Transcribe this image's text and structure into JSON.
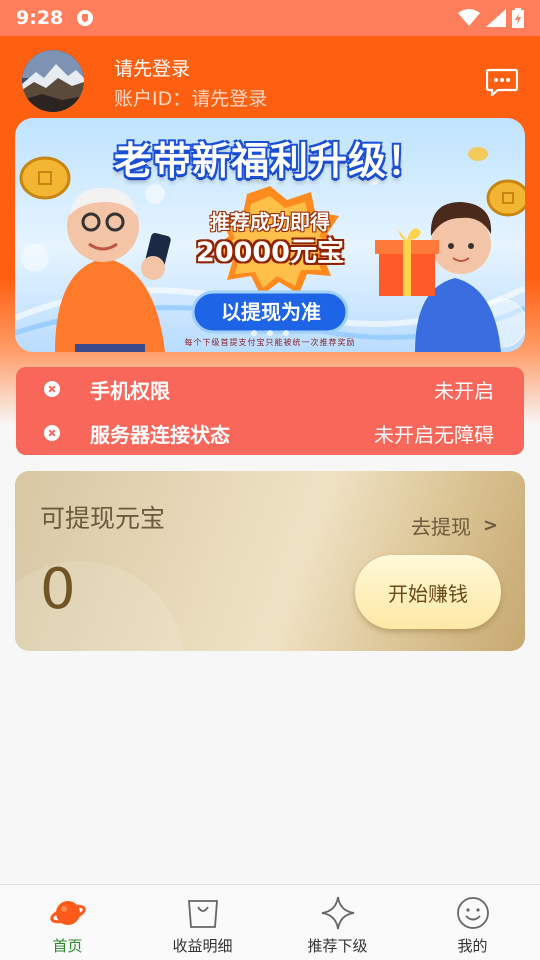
{
  "status_bar": {
    "time": "9:28"
  },
  "header": {
    "user_name": "请先登录",
    "account_id_prefix": "账户ID：",
    "account_id": "请先登录",
    "message_icon": "chat-bubble-icon"
  },
  "banner": {
    "title": "老带新福利升级！",
    "line1": "推荐成功即得",
    "line2": "20000元宝",
    "button_label": "以提现为准",
    "footnote": "每个下级首提支付宝只能被统一次推荐奖励",
    "dots": 3
  },
  "status_card": {
    "rows": [
      {
        "label": "手机权限",
        "value": "未开启",
        "icon": "close-circle-icon"
      },
      {
        "label": "服务器连接状态",
        "value": "未开启无障碍",
        "icon": "close-circle-icon"
      }
    ]
  },
  "earnings": {
    "title": "可提现元宝",
    "withdraw_label": "去提现",
    "chevron": ">",
    "amount": "0",
    "start_button": "开始赚钱"
  },
  "nav": {
    "items": [
      {
        "label": "首页",
        "icon": "planet-icon",
        "active": true
      },
      {
        "label": "收益明细",
        "icon": "shopping-bag-icon",
        "active": false
      },
      {
        "label": "推荐下级",
        "icon": "sparkle-star-icon",
        "active": false
      },
      {
        "label": "我的",
        "icon": "smiley-icon",
        "active": false
      }
    ]
  },
  "colors": {
    "header_orange": "#ff5f10",
    "status_card_red": "#f9665a",
    "nav_active_green": "#2a8a2a",
    "gold": "#d9c291"
  }
}
